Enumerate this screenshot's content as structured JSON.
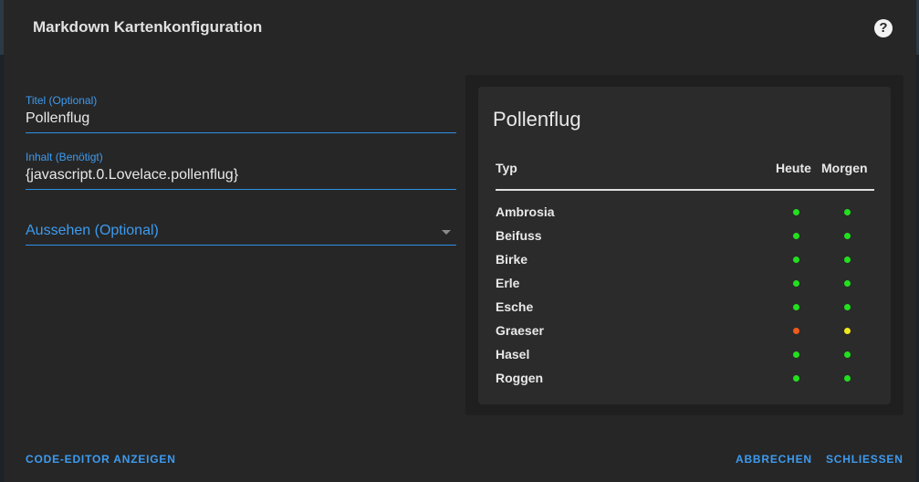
{
  "dialog": {
    "title": "Markdown Kartenkonfiguration",
    "help_icon": "help-circle-icon"
  },
  "form": {
    "title_field": {
      "label": "Titel (Optional)",
      "value": "Pollenflug"
    },
    "content_field": {
      "label": "Inhalt (Benötigt)",
      "value": "{javascript.0.Lovelace.pollenflug}"
    },
    "appearance_select": {
      "label": "Aussehen (Optional)"
    }
  },
  "preview": {
    "title": "Pollenflug",
    "columns": [
      "Typ",
      "Heute",
      "Morgen"
    ],
    "rows": [
      {
        "name": "Ambrosia",
        "today": "#22e01e",
        "tomorrow": "#22e01e"
      },
      {
        "name": "Beifuss",
        "today": "#22e01e",
        "tomorrow": "#22e01e"
      },
      {
        "name": "Birke",
        "today": "#22e01e",
        "tomorrow": "#22e01e"
      },
      {
        "name": "Erle",
        "today": "#22e01e",
        "tomorrow": "#22e01e"
      },
      {
        "name": "Esche",
        "today": "#22e01e",
        "tomorrow": "#22e01e"
      },
      {
        "name": "Graeser",
        "today": "#f05a1a",
        "tomorrow": "#f0e81e"
      },
      {
        "name": "Hasel",
        "today": "#22e01e",
        "tomorrow": "#22e01e"
      },
      {
        "name": "Roggen",
        "today": "#22e01e",
        "tomorrow": "#22e01e"
      }
    ]
  },
  "footer": {
    "code_editor_label": "CODE-EDITOR ANZEIGEN",
    "cancel_label": "ABBRECHEN",
    "close_label": "SCHLIESSEN"
  },
  "colors": {
    "accent": "#3d9bf0",
    "background": "#262626",
    "card": "#2b2b2b"
  }
}
